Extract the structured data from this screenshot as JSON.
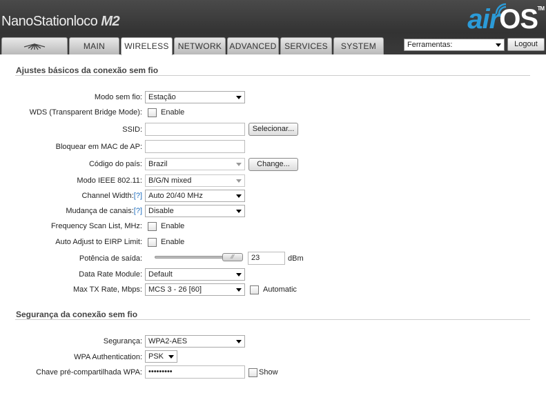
{
  "header": {
    "product_name": "NanoStation",
    "product_variant": "loco",
    "product_model": "M2",
    "brand_air": "air",
    "brand_os": "OS",
    "brand_tm": "TM"
  },
  "tabs": [
    {
      "label": "",
      "icon": "ubiquiti-logo-icon"
    },
    {
      "label": "MAIN"
    },
    {
      "label": "WIRELESS",
      "active": true
    },
    {
      "label": "NETWORK"
    },
    {
      "label": "ADVANCED"
    },
    {
      "label": "SERVICES"
    },
    {
      "label": "SYSTEM"
    }
  ],
  "tools": {
    "selected": "Ferramentas:"
  },
  "logout_label": "Logout",
  "basic": {
    "title": "Ajustes básicos da conexão sem fio",
    "wireless_mode": {
      "label": "Modo sem fio:",
      "value": "Estação"
    },
    "wds": {
      "label": "WDS (Transparent Bridge Mode):",
      "check_label": "Enable",
      "checked": false
    },
    "ssid": {
      "label": "SSID:",
      "value": "",
      "button": "Selecionar..."
    },
    "lock_mac": {
      "label": "Bloquear em MAC de AP:",
      "value": ""
    },
    "country": {
      "label": "Código do país:",
      "value": "Brazil",
      "button": "Change..."
    },
    "ieee_mode": {
      "label": "Modo IEEE 802.11:",
      "value": "B/G/N mixed"
    },
    "channel_width": {
      "label": "Channel Width:",
      "help": "[?]",
      "value": "Auto 20/40 MHz"
    },
    "channel_shift": {
      "label": "Mudança de canais:",
      "help": "[?]",
      "value": "Disable"
    },
    "freq_scan": {
      "label": "Frequency Scan List, MHz:",
      "check_label": "Enable",
      "checked": false
    },
    "auto_eirp": {
      "label": "Auto Adjust to EIRP Limit:",
      "check_label": "Enable",
      "checked": false
    },
    "output_power": {
      "label": "Potência de saída:",
      "value": "23",
      "unit": "dBm",
      "slider_fraction": 1.0
    },
    "data_rate_module": {
      "label": "Data Rate Module:",
      "value": "Default"
    },
    "max_tx_rate": {
      "label": "Max TX Rate, Mbps:",
      "value": "MCS 3 - 26 [60]",
      "check_label": "Automatic",
      "checked": false
    }
  },
  "security": {
    "title": "Segurança da conexão sem fio",
    "security": {
      "label": "Segurança:",
      "value": "WPA2-AES"
    },
    "wpa_auth": {
      "label": "WPA Authentication:",
      "value": "PSK"
    },
    "psk": {
      "label": "Chave pré-compartilhada WPA:",
      "value": "•••••••••",
      "check_label": "Show",
      "checked": false
    }
  },
  "colors": {
    "accent_blue": "#2b9bd8",
    "header_bg": "#3b3b3b",
    "help_link": "#1f6fbf"
  }
}
